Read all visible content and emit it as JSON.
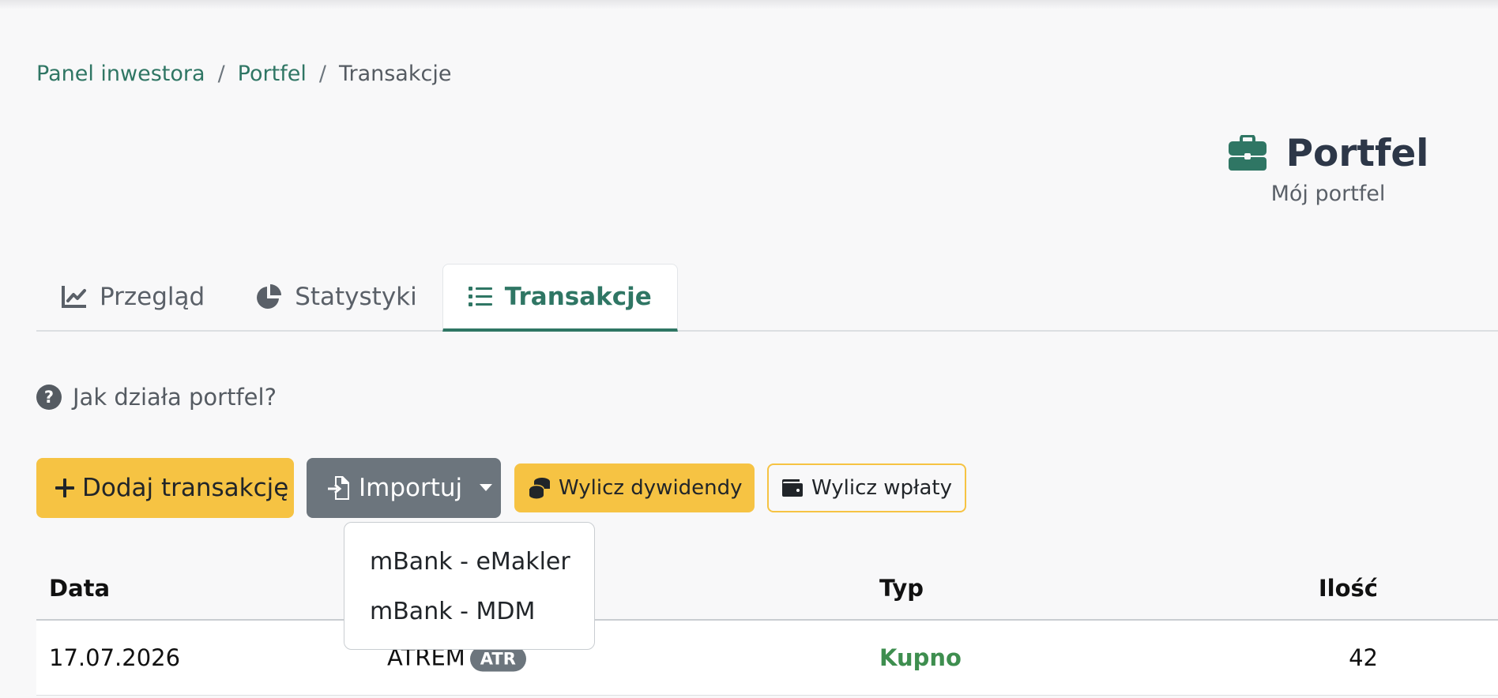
{
  "breadcrumb": {
    "items": [
      "Panel inwestora",
      "Portfel"
    ],
    "current": "Transakcje",
    "separator": "/"
  },
  "header": {
    "title": "Portfel",
    "subtitle": "Mój portfel",
    "icon": "briefcase-icon"
  },
  "tabs": [
    {
      "label": "Przegląd",
      "icon": "line-chart-icon",
      "active": false
    },
    {
      "label": "Statystyki",
      "icon": "pie-chart-icon",
      "active": false
    },
    {
      "label": "Transakcje",
      "icon": "list-icon",
      "active": true
    }
  ],
  "help": {
    "label": "Jak działa portfel?"
  },
  "actions": {
    "add": "Dodaj transakcję",
    "import": "Importuj",
    "dividends": "Wylicz dywidendy",
    "deposits": "Wylicz wpłaty"
  },
  "import_menu": {
    "items": [
      "mBank - eMakler",
      "mBank - MDM"
    ]
  },
  "table": {
    "columns": {
      "date": "Data",
      "type": "Typ",
      "qty": "Ilość"
    },
    "rows": [
      {
        "date": "17.07.2026",
        "name": "ATREM",
        "ticker": "ATR",
        "type": "Kupno",
        "qty": "42"
      }
    ]
  },
  "colors": {
    "accent": "#2f7664",
    "warning": "#f6c343",
    "secondary": "#6c757d",
    "buy": "#3e8e4f"
  }
}
